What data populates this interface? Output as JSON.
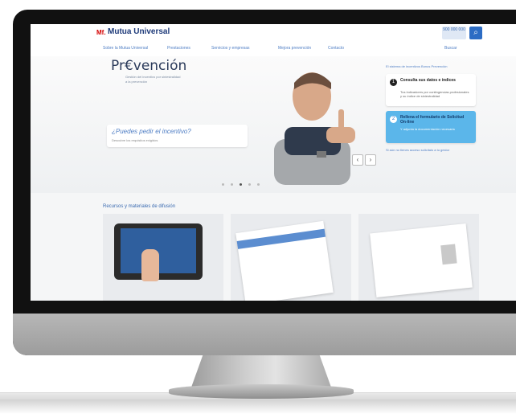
{
  "site": {
    "logo_mark": "Mf.",
    "logo": "Mutua Universal",
    "phone": "900 000 000",
    "search_icon": "search-icon"
  },
  "nav": {
    "items": [
      "Sobre la Mutua Universal",
      "Prestaciones",
      "Servicios y empresas",
      "Mejora prevención",
      "Contacto",
      "Buscar"
    ]
  },
  "hero": {
    "logo_text": "Pr€vención",
    "logo_sub": "Gestión del incentivo por siniestralidad a la prevención",
    "question": "¿Puedes pedir el incentivo?",
    "question_sub": "Descubre los requisitos exigidos"
  },
  "side": {
    "intro": "El sistema de incentivos Bonus Prevención",
    "cards": [
      {
        "n": "1",
        "title": "Consulta sus datos e índices",
        "sub": "Tus indicadores por contingencias profesionales y su índice de siniestralidad"
      },
      {
        "n": "2",
        "title": "Rellena el formulario de Solicitud On-line",
        "sub": "Y adjunta la documentación necesaria"
      }
    ],
    "note": "Si aún no tienes acceso solicítalo a tu gestor"
  },
  "section": {
    "title": "Recursos y materiales de difusión"
  },
  "colors": {
    "accent": "#2c6cc4",
    "brand_red": "#d40000",
    "nav_text": "#4f7ec4"
  }
}
